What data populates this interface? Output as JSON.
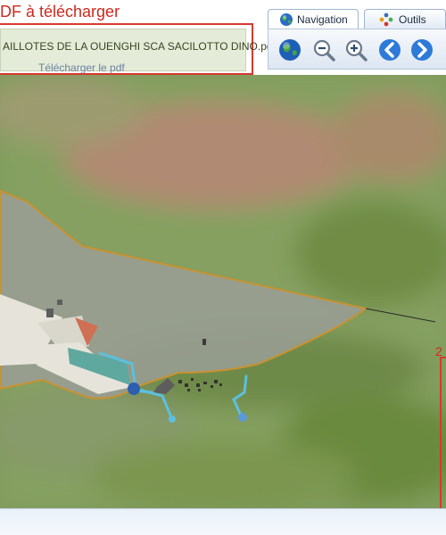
{
  "header": {
    "pdf_title": "DF à télécharger",
    "pdf_filename": "AILLOTES DE LA OUENGHI SCA SACILOTTO DINO.pdf",
    "pdf_link": "Télécharger le pdf"
  },
  "tabs": [
    {
      "label": "Navigation",
      "icon": "globe-icon",
      "active": true
    },
    {
      "label": "Outils",
      "icon": "tools-icon",
      "active": false
    }
  ],
  "toolbar": {
    "buttons": [
      "globe-icon",
      "zoom-out-icon",
      "zoom-in-icon",
      "back-arrow-icon",
      "forward-arrow-icon"
    ]
  },
  "map": {
    "side_label": "2"
  },
  "colors": {
    "accent_red": "#d6392d",
    "parcel_border": "#c9922e",
    "water": "#5bc0de",
    "toolbar_blue": "#2d7ad8"
  }
}
